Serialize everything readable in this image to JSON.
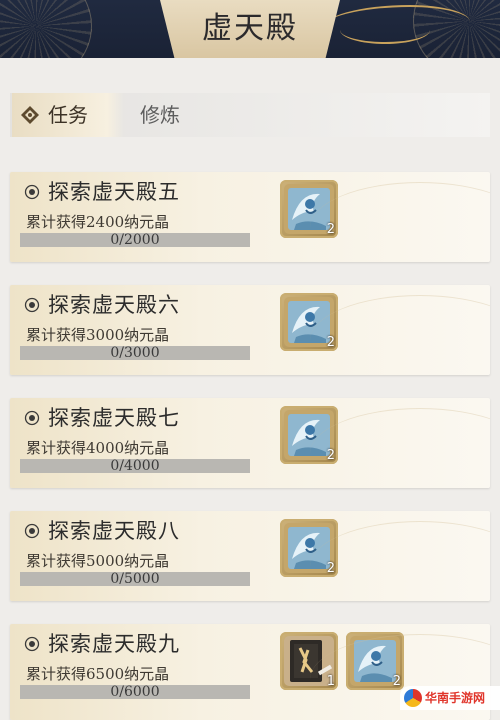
{
  "header": {
    "title": "虚天殿"
  },
  "tabs": [
    {
      "label": "任务",
      "active": true
    },
    {
      "label": "修炼",
      "active": false
    }
  ],
  "tasks": [
    {
      "name": "探索虚天殿五",
      "desc": "累计获得2400纳元晶",
      "progress_text": "0/2000",
      "progress": 0,
      "rewards": [
        {
          "icon": "crystal-scroll-icon",
          "count": "2"
        }
      ]
    },
    {
      "name": "探索虚天殿六",
      "desc": "累计获得3000纳元晶",
      "progress_text": "0/3000",
      "progress": 0,
      "rewards": [
        {
          "icon": "crystal-scroll-icon",
          "count": "2"
        }
      ]
    },
    {
      "name": "探索虚天殿七",
      "desc": "累计获得4000纳元晶",
      "progress_text": "0/4000",
      "progress": 0,
      "rewards": [
        {
          "icon": "crystal-scroll-icon",
          "count": "2"
        }
      ]
    },
    {
      "name": "探索虚天殿八",
      "desc": "累计获得5000纳元晶",
      "progress_text": "0/5000",
      "progress": 0,
      "rewards": [
        {
          "icon": "crystal-scroll-icon",
          "count": "2"
        }
      ]
    },
    {
      "name": "探索虚天殿九",
      "desc": "累计获得6500纳元晶",
      "progress_text": "0/6000",
      "progress": 0,
      "rewards": [
        {
          "icon": "manual-book-icon",
          "count": "1"
        },
        {
          "icon": "crystal-scroll-icon",
          "count": "2"
        }
      ]
    }
  ],
  "watermark": {
    "text": "华南手游网"
  },
  "colors": {
    "header_bg": "#1e273b",
    "gold": "#c8a25c",
    "card_bg": "#f7f1e2",
    "bar_bg": "#b9b7b2"
  }
}
